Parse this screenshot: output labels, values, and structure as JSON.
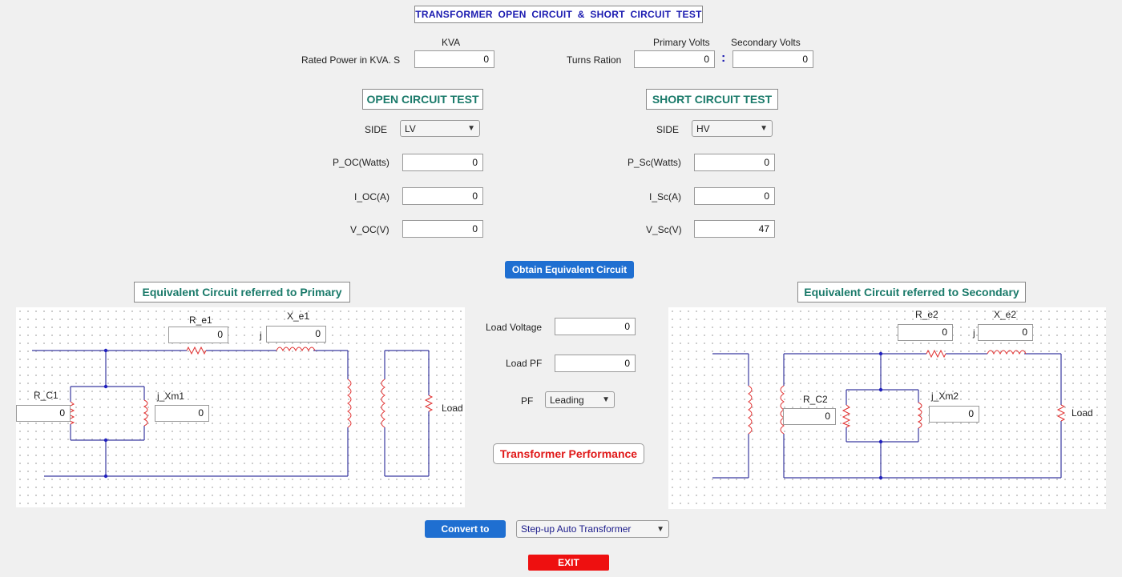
{
  "title": "TRANSFORMER  OPEN  CIRCUIT  &  SHORT  CIRCUIT  TEST",
  "rated": {
    "unit": "KVA",
    "label": "Rated Power in KVA. S",
    "value": "0"
  },
  "turns": {
    "label": "Turns Ration",
    "primary_label": "Primary Volts",
    "primary_value": "0",
    "colon": ":",
    "secondary_label": "Secondary Volts",
    "secondary_value": "0"
  },
  "oc": {
    "header": "OPEN CIRCUIT TEST",
    "side_label": "SIDE",
    "side_value": "LV",
    "p_label": "P_OC(Watts)",
    "p_value": "0",
    "i_label": "I_OC(A)",
    "i_value": "0",
    "v_label": "V_OC(V)",
    "v_value": "0"
  },
  "sc": {
    "header": "SHORT CIRCUIT TEST",
    "side_label": "SIDE",
    "side_value": "HV",
    "p_label": "P_Sc(Watts)",
    "p_value": "0",
    "i_label": "I_Sc(A)",
    "i_value": "0",
    "v_label": "V_Sc(V)",
    "v_value": "47"
  },
  "obtain_button": "Obtain Equivalent Circuit",
  "primary_circuit": {
    "header": "Equivalent Circuit referred to Primary",
    "re_label": "R_e1",
    "re_value": "0",
    "xe_label": "X_e1",
    "xe_j": "j",
    "xe_value": "0",
    "rc_label": "R_C1",
    "rc_value": "0",
    "xm_label": "j_Xm1",
    "xm_value": "0",
    "load_label": "Load"
  },
  "secondary_circuit": {
    "header": "Equivalent Circuit referred to Secondary",
    "re_label": "R_e2",
    "re_value": "0",
    "xe_label": "X_e2",
    "xe_j": "j",
    "xe_value": "0",
    "rc_label": "R_C2",
    "rc_value": "0",
    "xm_label": "j_Xm2",
    "xm_value": "0",
    "load_label": "Load"
  },
  "load": {
    "voltage_label": "Load Voltage",
    "voltage_value": "0",
    "pf_label": "Load PF",
    "pf_value": "0",
    "pf_type_label": "PF",
    "pf_type_value": "Leading"
  },
  "performance_button": "Transformer Performance",
  "convert": {
    "button": "Convert to",
    "option": "Step-up Auto Transformer"
  },
  "exit_button": "EXIT",
  "colors": {
    "wire": "#3a3aa0",
    "component": "#e03030",
    "header_text": "#1a7a6a",
    "title_text": "#1a1ab0",
    "button_blue": "#1f6fd1",
    "button_red": "#ee1010"
  }
}
